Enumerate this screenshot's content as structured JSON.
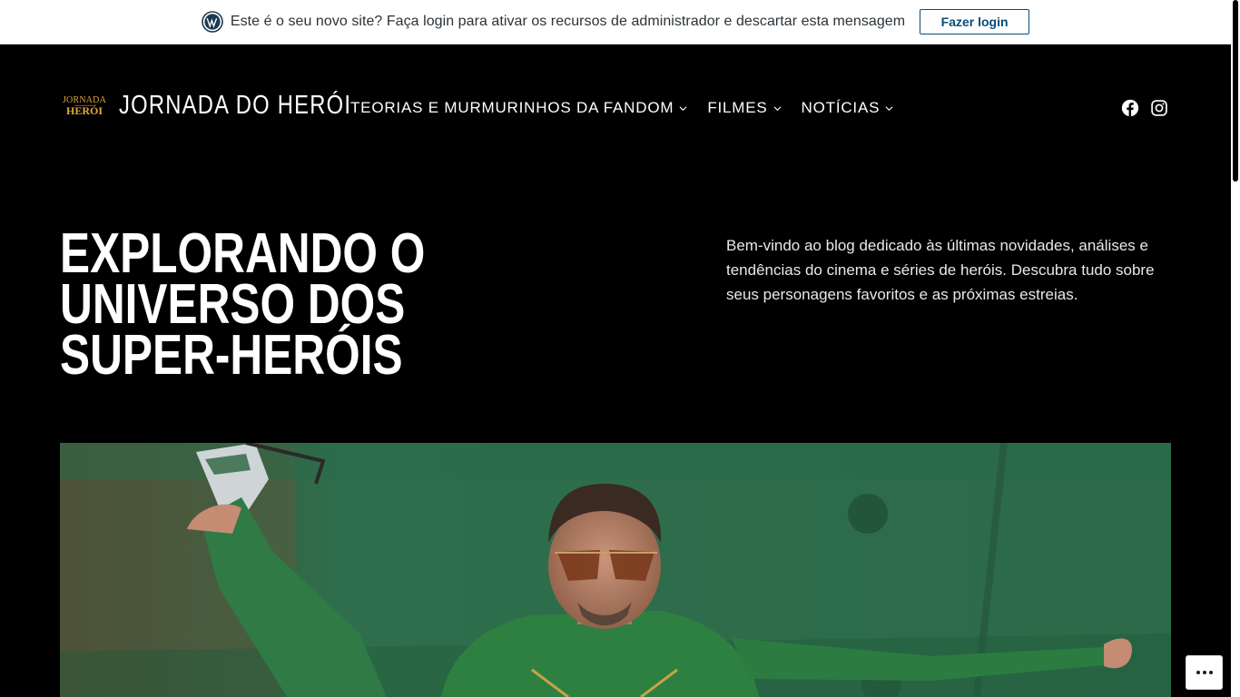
{
  "notice": {
    "text": "Este é o seu novo site? Faça login para ativar os recursos de administrador e descartar esta mensagem",
    "login_label": "Fazer login",
    "logo_icon": "wordpress-icon"
  },
  "site": {
    "logo_line1": "JORNADA",
    "logo_line2": "HERÓI",
    "title": "JORNADA DO HERÓI"
  },
  "nav": {
    "items": [
      {
        "label": "TEORIAS E MURMURINHOS DA FANDOM",
        "icon": "chevron-down-icon"
      },
      {
        "label": "FILMES",
        "icon": "chevron-down-icon"
      },
      {
        "label": "NOTÍCIAS",
        "icon": "chevron-down-icon"
      }
    ]
  },
  "social": {
    "facebook_icon": "facebook-icon",
    "instagram_icon": "instagram-icon"
  },
  "hero": {
    "title": "EXPLORANDO O UNIVERSO DOS SUPER-HERÓIS",
    "description": "Bem-vindo ao blog dedicado às últimas novidades, análises e tendências do cinema e séries de heróis. Descubra tudo sobre seus personagens favoritos e as próximas estreias."
  },
  "colors": {
    "background": "#000000",
    "accent_gold": "#d9a441",
    "link_blue": "#0a4b78",
    "image_green": "#2f6e4c"
  },
  "actions": {
    "more_icon": "ellipsis-icon"
  }
}
